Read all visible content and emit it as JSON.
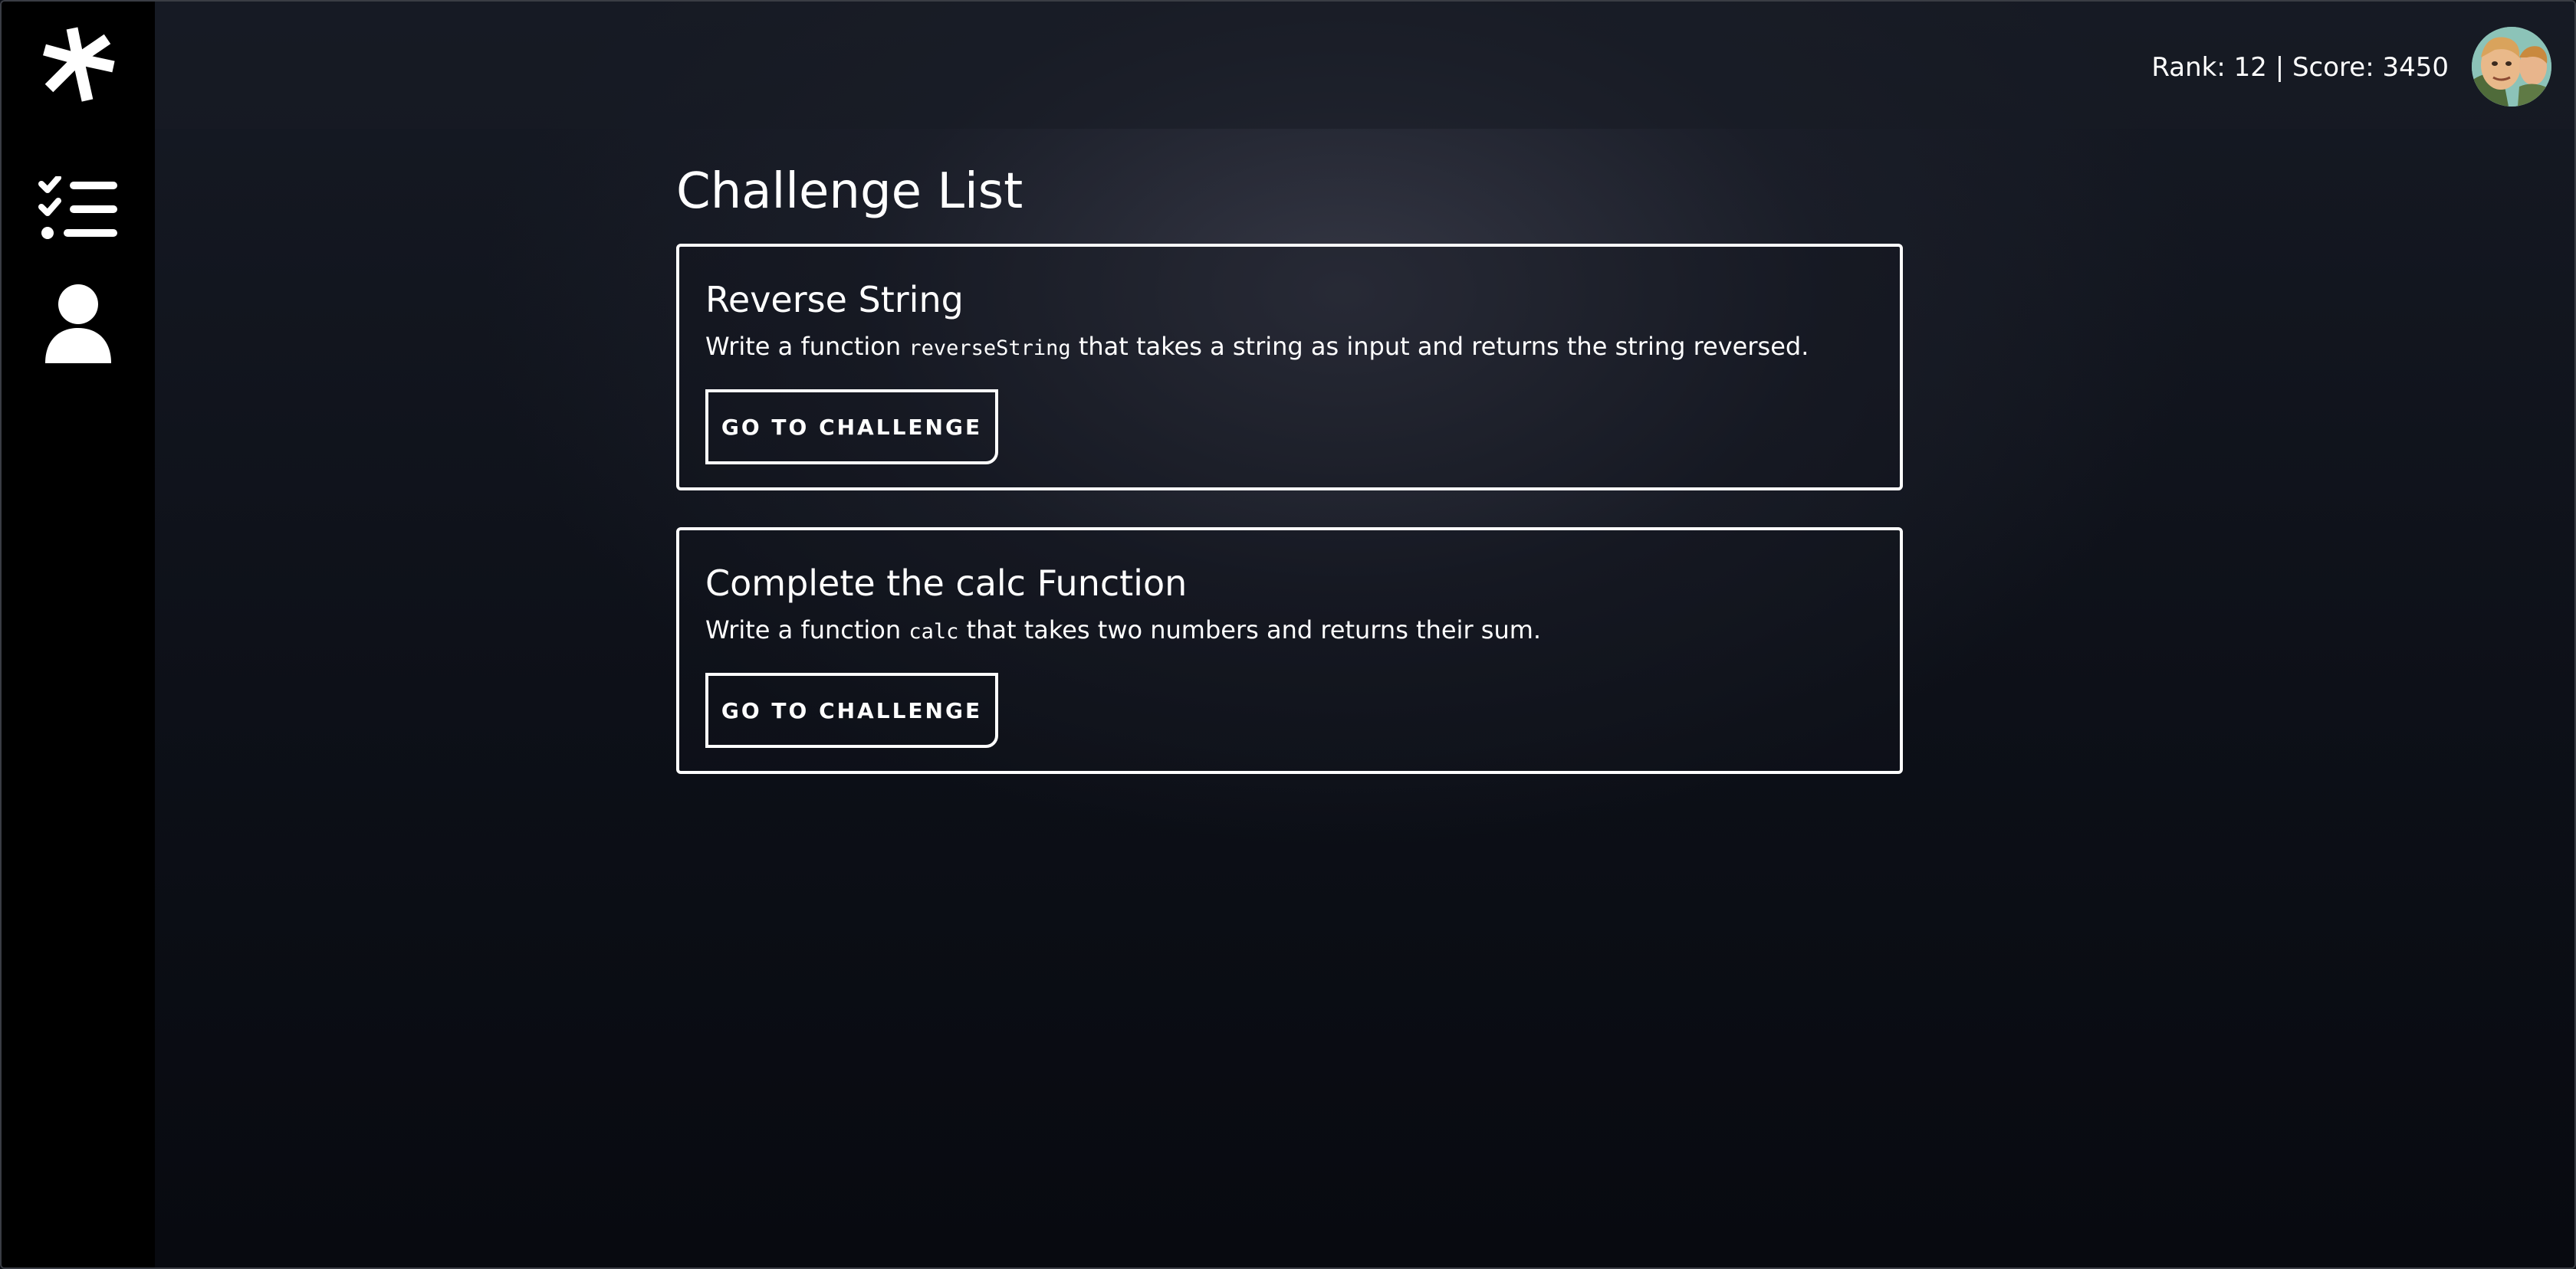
{
  "header": {
    "rank_score": "Rank: 12 | Score: 3450"
  },
  "sidebar": {
    "items": [
      {
        "icon": "logo-icon"
      },
      {
        "icon": "checklist-icon"
      },
      {
        "icon": "user-icon"
      }
    ]
  },
  "main": {
    "title": "Challenge List",
    "challenges": [
      {
        "title": "Reverse String",
        "desc_before": "Write a function ",
        "code": "reverseString",
        "desc_after": " that takes a string as input and returns the string reversed.",
        "button_label": "GO TO CHALLENGE"
      },
      {
        "title": "Complete the calc Function",
        "desc_before": "Write a function ",
        "code": "calc",
        "desc_after": " that takes two numbers and returns their sum.",
        "button_label": "GO TO CHALLENGE"
      }
    ]
  },
  "colors": {
    "background": "#0c0f16",
    "sidebar": "#000000",
    "text": "#ffffff",
    "card_border": "#ffffff"
  }
}
